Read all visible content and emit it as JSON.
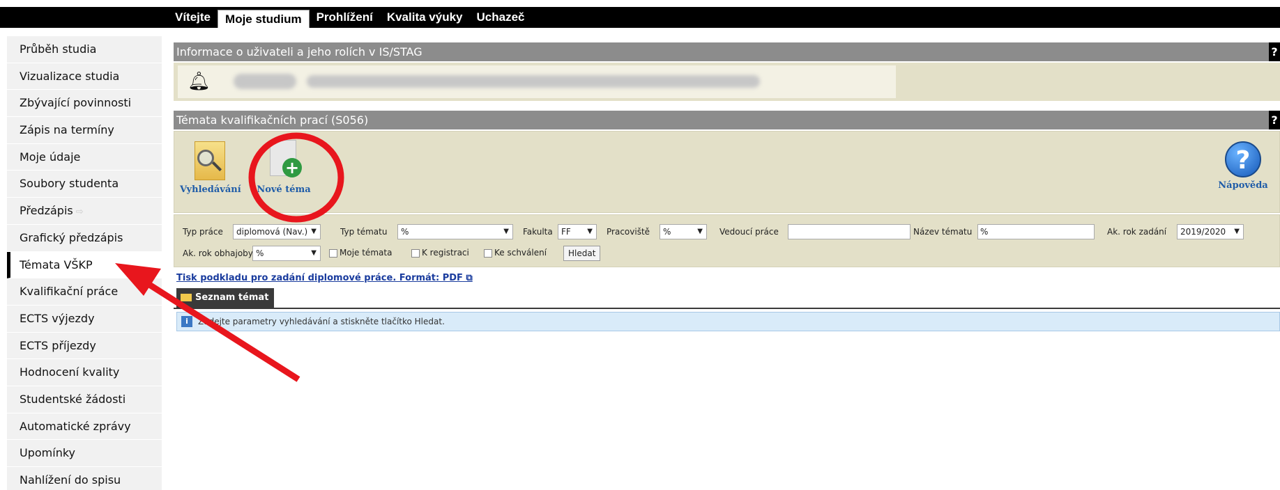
{
  "top_tabs": [
    "Vítejte",
    "Moje studium",
    "Prohlížení",
    "Kvalita výuky",
    "Uchazeč"
  ],
  "sidebar": {
    "items": [
      {
        "label": "Průběh studia"
      },
      {
        "label": "Vizualizace studia"
      },
      {
        "label": "Zbývající povinnosti"
      },
      {
        "label": "Zápis na termíny"
      },
      {
        "label": "Moje údaje"
      },
      {
        "label": "Soubory studenta"
      },
      {
        "label": "Předzápis"
      },
      {
        "label": "Grafický předzápis"
      },
      {
        "label": "Témata VŠKP"
      },
      {
        "label": "Kvalifikační práce"
      },
      {
        "label": "ECTS výjezdy"
      },
      {
        "label": "ECTS příjezdy"
      },
      {
        "label": "Hodnocení kvality"
      },
      {
        "label": "Studentské žádosti"
      },
      {
        "label": "Automatické zprávy"
      },
      {
        "label": "Upomínky"
      },
      {
        "label": "Nahlížení do spisu"
      }
    ],
    "active": "Témata VŠKP"
  },
  "user_panel": {
    "title": "Informace o uživateli a jeho rolích v IS/STAG",
    "help": "?"
  },
  "topics_panel": {
    "title": "Témata kvalifikačních prací (S056)",
    "help": "?"
  },
  "toolbar": {
    "search_label": "Vyhledávání",
    "new_topic_label": "Nové téma",
    "help_label": "Nápověda",
    "help_glyph": "?"
  },
  "filters": {
    "typ_prace_label": "Typ práce",
    "typ_prace_value": "diplomová (Nav.)",
    "typ_tematu_label": "Typ tématu",
    "typ_tematu_value": "%",
    "fakulta_label": "Fakulta",
    "fakulta_value": "FF",
    "pracoviste_label": "Pracoviště",
    "pracoviste_value": "%",
    "vedouci_label": "Vedoucí práce",
    "vedouci_value": "",
    "nazev_label": "Název tématu",
    "nazev_value": "%",
    "ak_rok_zadani_label": "Ak. rok zadání",
    "ak_rok_zadani_value": "2019/2020",
    "ak_rok_obhajoby_label": "Ak. rok obhajoby",
    "ak_rok_obhajoby_value": "%",
    "moje_temata": "Moje témata",
    "k_registraci": "K registraci",
    "ke_schvaleni": "Ke schválení",
    "hledat": "Hledat",
    "dropdown_glyph": "▼"
  },
  "print_link": "Tisk podkladu pro zadání diplomové práce. Formát: PDF",
  "list_tab": "Seznam témat",
  "info_message": "Zadejte parametry vyhledávání a stiskněte tlačítko Hledat.",
  "annotation_color": "#e8161d"
}
